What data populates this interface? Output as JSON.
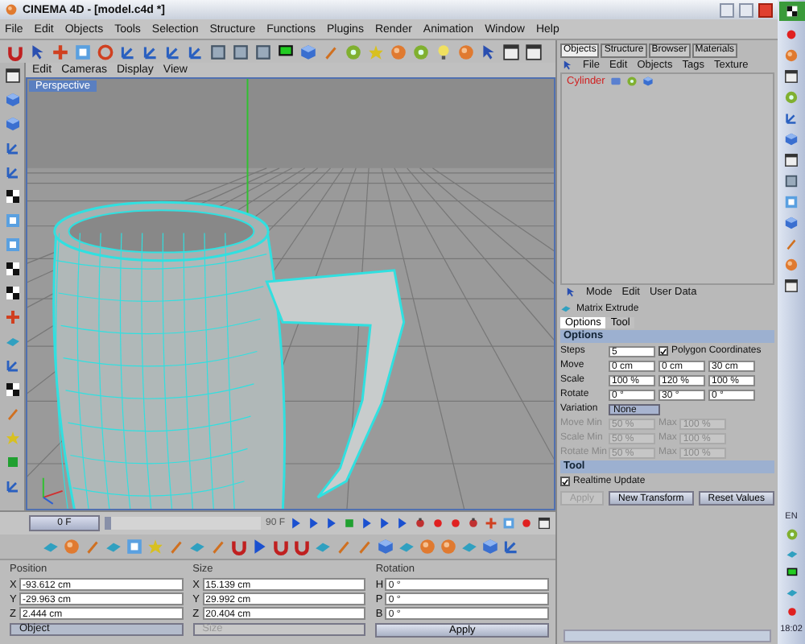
{
  "window": {
    "title": "CINEMA 4D - [model.c4d *]"
  },
  "menu": [
    "File",
    "Edit",
    "Objects",
    "Tools",
    "Selection",
    "Structure",
    "Functions",
    "Plugins",
    "Render",
    "Animation",
    "Window",
    "Help"
  ],
  "viewport": {
    "menu": [
      "Edit",
      "Cameras",
      "Display",
      "View"
    ],
    "camera_label": "Perspective"
  },
  "timeline": {
    "current_frame": "0 F",
    "end_frame": "90 F",
    "level": 0
  },
  "coordinates": {
    "columns": [
      {
        "heading": "Position",
        "rows": [
          {
            "axis": "X",
            "value": "-93.612 cm"
          },
          {
            "axis": "Y",
            "value": "-29.963 cm"
          },
          {
            "axis": "Z",
            "value": "2.444 cm"
          }
        ],
        "dropdown": {
          "value": "Object",
          "disabled": false
        }
      },
      {
        "heading": "Size",
        "rows": [
          {
            "axis": "X",
            "value": "15.139 cm"
          },
          {
            "axis": "Y",
            "value": "29.992 cm"
          },
          {
            "axis": "Z",
            "value": "20.404 cm"
          }
        ],
        "dropdown": {
          "value": "Size",
          "disabled": true
        }
      },
      {
        "heading": "Rotation",
        "rows": [
          {
            "axis": "H",
            "value": "0 °"
          },
          {
            "axis": "P",
            "value": "0 °"
          },
          {
            "axis": "B",
            "value": "0 °"
          }
        ],
        "button": "Apply"
      }
    ]
  },
  "object_manager": {
    "tabs": [
      {
        "label": "Objects",
        "selected": true
      },
      {
        "label": "Structure",
        "selected": false
      },
      {
        "label": "Browser",
        "selected": false
      },
      {
        "label": "Materials",
        "selected": false
      }
    ],
    "menu": [
      "File",
      "Edit",
      "Objects",
      "Tags",
      "Texture"
    ],
    "objects": [
      {
        "name": "Cylinder"
      }
    ]
  },
  "attributes": {
    "menu": [
      "Mode",
      "Edit",
      "User Data"
    ],
    "tool_name": "Matrix Extrude",
    "tabs": [
      {
        "label": "Options",
        "selected": true
      },
      {
        "label": "Tool",
        "selected": false
      }
    ],
    "options_title": "Options",
    "rows": [
      {
        "kind": "fields",
        "label": "Steps",
        "values": [
          "5"
        ],
        "checkbox": {
          "label": "Polygon Coordinates",
          "checked": true
        }
      },
      {
        "kind": "fields",
        "label": "Move",
        "values": [
          "0 cm",
          "0 cm",
          "30 cm"
        ]
      },
      {
        "kind": "fields",
        "label": "Scale",
        "values": [
          "100 %",
          "120 %",
          "100 %"
        ]
      },
      {
        "kind": "fields",
        "label": "Rotate",
        "values": [
          "0 °",
          "30 °",
          "0 °"
        ]
      },
      {
        "kind": "dropdown",
        "label": "Variation",
        "value": "None"
      },
      {
        "kind": "range",
        "label": "Move Min",
        "values": [
          "50 %"
        ],
        "max_label": "Max",
        "max_value": "100 %",
        "disabled": true
      },
      {
        "kind": "range",
        "label": "Scale Min",
        "values": [
          "50 %"
        ],
        "max_label": "Max",
        "max_value": "100 %",
        "disabled": true
      },
      {
        "kind": "range",
        "label": "Rotate Min",
        "values": [
          "50 %"
        ],
        "max_label": "Max",
        "max_value": "100 %",
        "disabled": true
      }
    ],
    "tool_title": "Tool",
    "realtime_update": {
      "label": "Realtime Update",
      "checked": true
    },
    "buttons": [
      {
        "label": "Apply",
        "disabled": true
      },
      {
        "label": "New Transform",
        "disabled": false
      },
      {
        "label": "Reset Values",
        "disabled": false
      }
    ]
  },
  "taskbar": {
    "language": "EN",
    "clock": "18:02"
  }
}
